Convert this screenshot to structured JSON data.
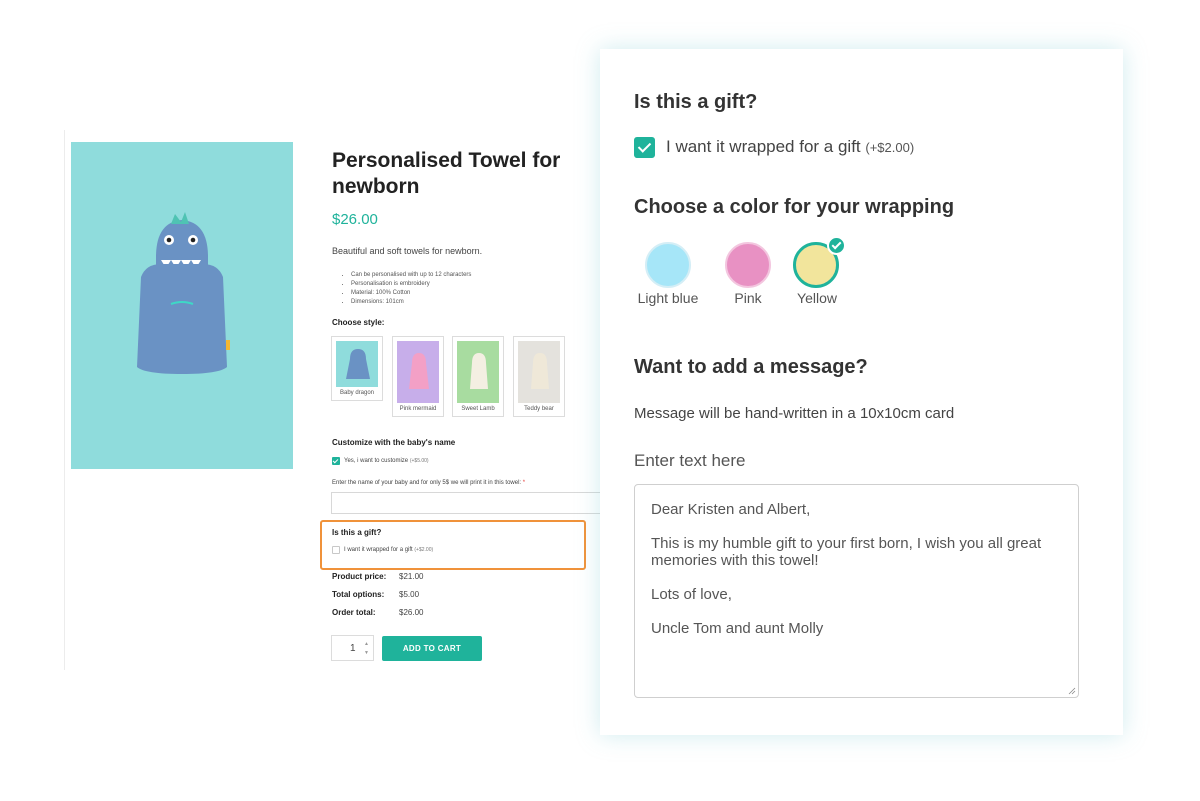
{
  "product": {
    "title": "Personalised Towel for newborn",
    "price": "$26.00",
    "description": "Beautiful and soft towels for newborn.",
    "features": [
      "Can be personalised with up to 12 characters",
      "Personalisation is embroidery",
      "Material: 100% Cotton",
      "Dimensions: 101cm"
    ],
    "style_label": "Choose style:",
    "styles": [
      {
        "name": "Baby dragon",
        "color": "#8fdcdc"
      },
      {
        "name": "Pink mermaid",
        "color": "#c7aeea"
      },
      {
        "name": "Sweet Lamb",
        "color": "#a8dca0"
      },
      {
        "name": "Teddy bear",
        "color": "#e4e2dd"
      }
    ],
    "customize_label": "Customize with the baby's name",
    "customize_option": "Yes, i want to customize",
    "customize_price": "(+$5.00)",
    "name_prompt": "Enter the name of your baby and for only 5$ we will print it in this towel:",
    "name_required": "*",
    "gift_label": "Is this a gift?",
    "gift_option": "I want it wrapped for a gift",
    "gift_price": "(+$2.00)",
    "totals": [
      {
        "label": "Product price:",
        "value": "$21.00"
      },
      {
        "label": "Total options:",
        "value": "$5.00"
      },
      {
        "label": "Order total:",
        "value": "$26.00"
      }
    ],
    "quantity": "1",
    "add_to_cart": "ADD TO CART"
  },
  "panel": {
    "gift_heading": "Is this a gift?",
    "gift_option": "I want it wrapped for a gift",
    "gift_price": "(+$2.00)",
    "wrap_heading": "Choose a color for your wrapping",
    "colors": [
      {
        "label": "Light blue",
        "hex": "#a6e6f8"
      },
      {
        "label": "Pink",
        "hex": "#e891c3"
      },
      {
        "label": "Yellow",
        "hex": "#f2e59c"
      }
    ],
    "message_heading": "Want to add a message?",
    "message_info": "Message will be hand-written in a 10x10cm card",
    "message_label": "Enter text here",
    "message_text": "Dear Kristen and Albert,\n\nThis is my humble gift to your first born, I wish you all great memories with this towel!\n\nLots of love,\n\nUncle Tom and aunt Molly"
  },
  "colors": {
    "accent": "#1fb39b",
    "highlight": "#f0923a"
  }
}
